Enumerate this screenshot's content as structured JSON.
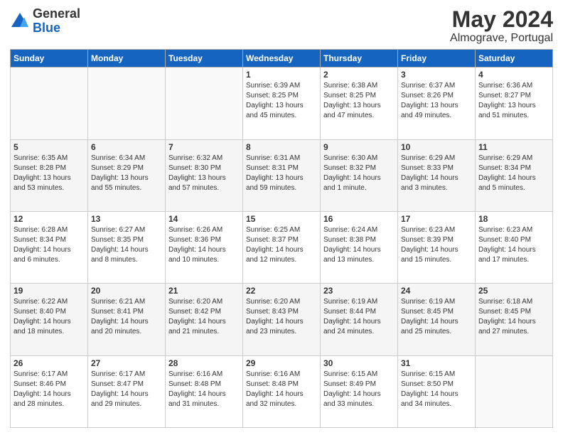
{
  "header": {
    "logo_general": "General",
    "logo_blue": "Blue",
    "month_title": "May 2024",
    "subtitle": "Almograve, Portugal"
  },
  "days_of_week": [
    "Sunday",
    "Monday",
    "Tuesday",
    "Wednesday",
    "Thursday",
    "Friday",
    "Saturday"
  ],
  "weeks": [
    [
      {
        "day": "",
        "info": ""
      },
      {
        "day": "",
        "info": ""
      },
      {
        "day": "",
        "info": ""
      },
      {
        "day": "1",
        "info": "Sunrise: 6:39 AM\nSunset: 8:25 PM\nDaylight: 13 hours\nand 45 minutes."
      },
      {
        "day": "2",
        "info": "Sunrise: 6:38 AM\nSunset: 8:25 PM\nDaylight: 13 hours\nand 47 minutes."
      },
      {
        "day": "3",
        "info": "Sunrise: 6:37 AM\nSunset: 8:26 PM\nDaylight: 13 hours\nand 49 minutes."
      },
      {
        "day": "4",
        "info": "Sunrise: 6:36 AM\nSunset: 8:27 PM\nDaylight: 13 hours\nand 51 minutes."
      }
    ],
    [
      {
        "day": "5",
        "info": "Sunrise: 6:35 AM\nSunset: 8:28 PM\nDaylight: 13 hours\nand 53 minutes."
      },
      {
        "day": "6",
        "info": "Sunrise: 6:34 AM\nSunset: 8:29 PM\nDaylight: 13 hours\nand 55 minutes."
      },
      {
        "day": "7",
        "info": "Sunrise: 6:32 AM\nSunset: 8:30 PM\nDaylight: 13 hours\nand 57 minutes."
      },
      {
        "day": "8",
        "info": "Sunrise: 6:31 AM\nSunset: 8:31 PM\nDaylight: 13 hours\nand 59 minutes."
      },
      {
        "day": "9",
        "info": "Sunrise: 6:30 AM\nSunset: 8:32 PM\nDaylight: 14 hours\nand 1 minute."
      },
      {
        "day": "10",
        "info": "Sunrise: 6:29 AM\nSunset: 8:33 PM\nDaylight: 14 hours\nand 3 minutes."
      },
      {
        "day": "11",
        "info": "Sunrise: 6:29 AM\nSunset: 8:34 PM\nDaylight: 14 hours\nand 5 minutes."
      }
    ],
    [
      {
        "day": "12",
        "info": "Sunrise: 6:28 AM\nSunset: 8:34 PM\nDaylight: 14 hours\nand 6 minutes."
      },
      {
        "day": "13",
        "info": "Sunrise: 6:27 AM\nSunset: 8:35 PM\nDaylight: 14 hours\nand 8 minutes."
      },
      {
        "day": "14",
        "info": "Sunrise: 6:26 AM\nSunset: 8:36 PM\nDaylight: 14 hours\nand 10 minutes."
      },
      {
        "day": "15",
        "info": "Sunrise: 6:25 AM\nSunset: 8:37 PM\nDaylight: 14 hours\nand 12 minutes."
      },
      {
        "day": "16",
        "info": "Sunrise: 6:24 AM\nSunset: 8:38 PM\nDaylight: 14 hours\nand 13 minutes."
      },
      {
        "day": "17",
        "info": "Sunrise: 6:23 AM\nSunset: 8:39 PM\nDaylight: 14 hours\nand 15 minutes."
      },
      {
        "day": "18",
        "info": "Sunrise: 6:23 AM\nSunset: 8:40 PM\nDaylight: 14 hours\nand 17 minutes."
      }
    ],
    [
      {
        "day": "19",
        "info": "Sunrise: 6:22 AM\nSunset: 8:40 PM\nDaylight: 14 hours\nand 18 minutes."
      },
      {
        "day": "20",
        "info": "Sunrise: 6:21 AM\nSunset: 8:41 PM\nDaylight: 14 hours\nand 20 minutes."
      },
      {
        "day": "21",
        "info": "Sunrise: 6:20 AM\nSunset: 8:42 PM\nDaylight: 14 hours\nand 21 minutes."
      },
      {
        "day": "22",
        "info": "Sunrise: 6:20 AM\nSunset: 8:43 PM\nDaylight: 14 hours\nand 23 minutes."
      },
      {
        "day": "23",
        "info": "Sunrise: 6:19 AM\nSunset: 8:44 PM\nDaylight: 14 hours\nand 24 minutes."
      },
      {
        "day": "24",
        "info": "Sunrise: 6:19 AM\nSunset: 8:45 PM\nDaylight: 14 hours\nand 25 minutes."
      },
      {
        "day": "25",
        "info": "Sunrise: 6:18 AM\nSunset: 8:45 PM\nDaylight: 14 hours\nand 27 minutes."
      }
    ],
    [
      {
        "day": "26",
        "info": "Sunrise: 6:17 AM\nSunset: 8:46 PM\nDaylight: 14 hours\nand 28 minutes."
      },
      {
        "day": "27",
        "info": "Sunrise: 6:17 AM\nSunset: 8:47 PM\nDaylight: 14 hours\nand 29 minutes."
      },
      {
        "day": "28",
        "info": "Sunrise: 6:16 AM\nSunset: 8:48 PM\nDaylight: 14 hours\nand 31 minutes."
      },
      {
        "day": "29",
        "info": "Sunrise: 6:16 AM\nSunset: 8:48 PM\nDaylight: 14 hours\nand 32 minutes."
      },
      {
        "day": "30",
        "info": "Sunrise: 6:15 AM\nSunset: 8:49 PM\nDaylight: 14 hours\nand 33 minutes."
      },
      {
        "day": "31",
        "info": "Sunrise: 6:15 AM\nSunset: 8:50 PM\nDaylight: 14 hours\nand 34 minutes."
      },
      {
        "day": "",
        "info": ""
      }
    ]
  ]
}
